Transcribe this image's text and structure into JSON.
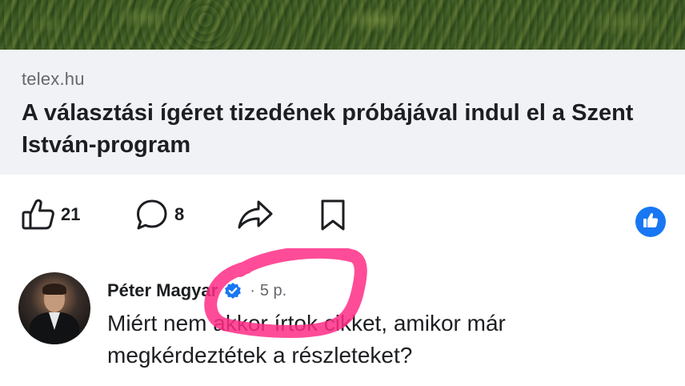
{
  "link": {
    "domain": "telex.hu",
    "title": "A választási ígéret tizedének próbájával indul el a Szent István-program"
  },
  "actions": {
    "like_count": "21",
    "comment_count": "8",
    "like_icon": "thumbs-up-icon",
    "comment_icon": "speech-bubble-icon",
    "share_icon": "share-arrow-icon",
    "save_icon": "bookmark-icon"
  },
  "comment": {
    "author": "Péter Magyar",
    "separator": "·",
    "timestamp": "5 p.",
    "text": "Miért nem akkor írtok cikket, amikor már megkérdeztétek a részleteket?"
  },
  "colors": {
    "accent": "#1877f2",
    "card_bg": "#f0f2f5",
    "highlight": "#ff2d86",
    "muted_text": "#65676b"
  }
}
